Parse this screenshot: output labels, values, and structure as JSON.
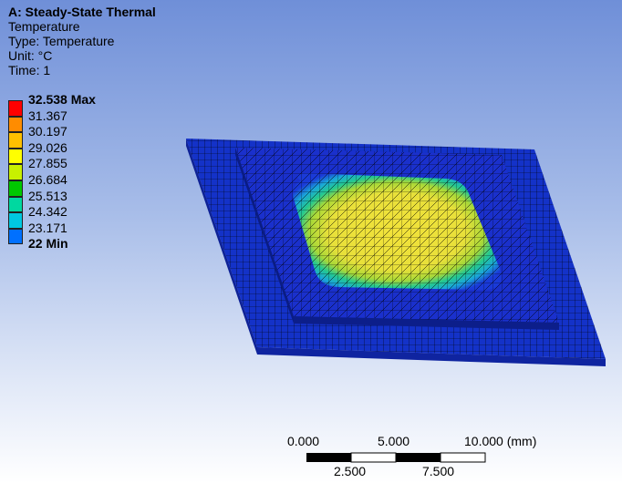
{
  "info": {
    "title": "A: Steady-State Thermal",
    "line1": "Temperature",
    "line2": "Type: Temperature",
    "line3": "Unit: °C",
    "line4": "Time: 1"
  },
  "legend": {
    "entries": [
      {
        "label": "32.538 Max",
        "color": "#ff0000",
        "bold": true
      },
      {
        "label": "31.367",
        "color": "#ff8c00",
        "bold": false
      },
      {
        "label": "30.197",
        "color": "#ffc000",
        "bold": false
      },
      {
        "label": "29.026",
        "color": "#ffff00",
        "bold": false
      },
      {
        "label": "27.855",
        "color": "#c8f000",
        "bold": false
      },
      {
        "label": "26.684",
        "color": "#00c800",
        "bold": false
      },
      {
        "label": "25.513",
        "color": "#00d8a0",
        "bold": false
      },
      {
        "label": "24.342",
        "color": "#00c8e0",
        "bold": false
      },
      {
        "label": "23.171",
        "color": "#0070ff",
        "bold": false
      },
      {
        "label": "22 Min",
        "color": "#0000ff",
        "bold": true
      }
    ]
  },
  "scale": {
    "top_labels": [
      "0.000",
      "5.000",
      "10.000 (mm)"
    ],
    "bottom_labels": [
      "2.500",
      "7.500"
    ]
  },
  "colors": {
    "substrate": "#1230c8",
    "cold": "#1a2fd0",
    "warm": "#00c8b0",
    "hot": "#f0e040",
    "mesh": "#000000"
  }
}
